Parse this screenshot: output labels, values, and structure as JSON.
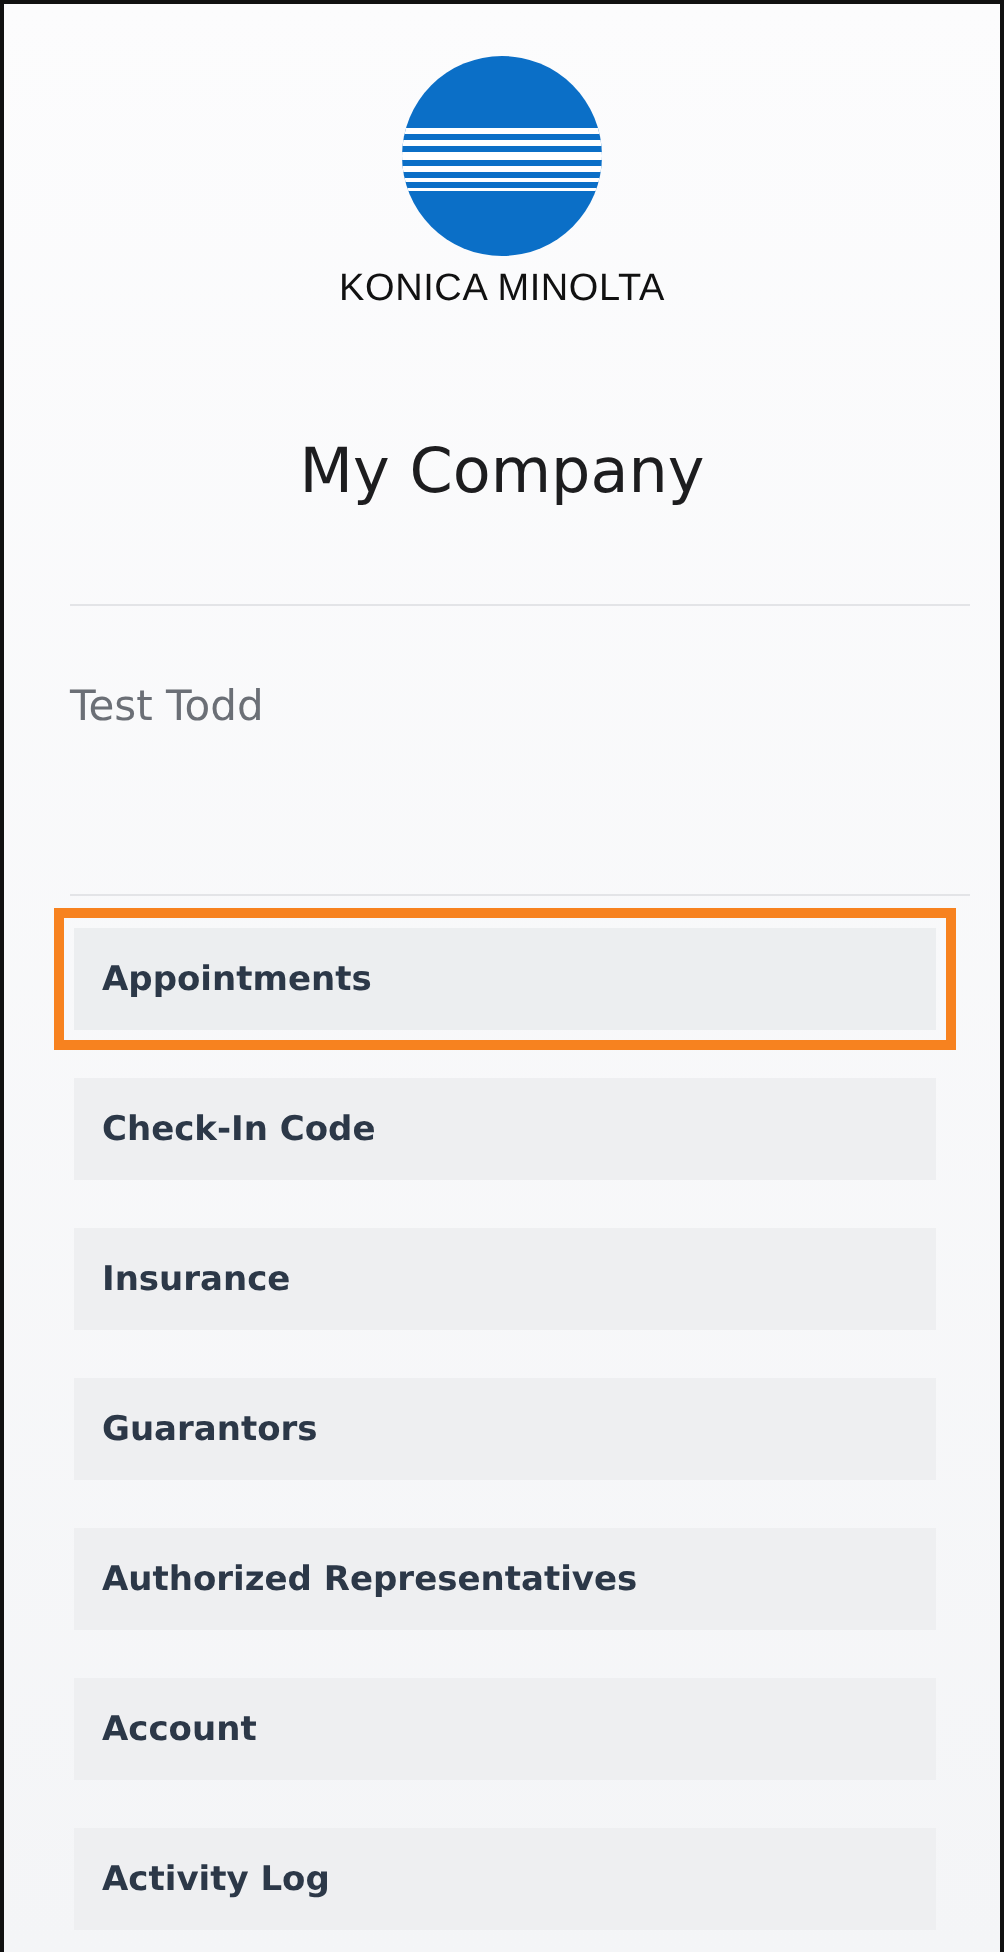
{
  "brand": {
    "wordmark": "KONICA MINOLTA"
  },
  "company": {
    "name": "My Company"
  },
  "user": {
    "name": "Test Todd"
  },
  "menu": [
    {
      "label": "Appointments",
      "selected": true
    },
    {
      "label": "Check-In Code",
      "selected": false
    },
    {
      "label": "Insurance",
      "selected": false
    },
    {
      "label": "Guarantors",
      "selected": false
    },
    {
      "label": "Authorized Representatives",
      "selected": false
    },
    {
      "label": "Account",
      "selected": false
    },
    {
      "label": "Activity Log",
      "selected": false
    }
  ]
}
